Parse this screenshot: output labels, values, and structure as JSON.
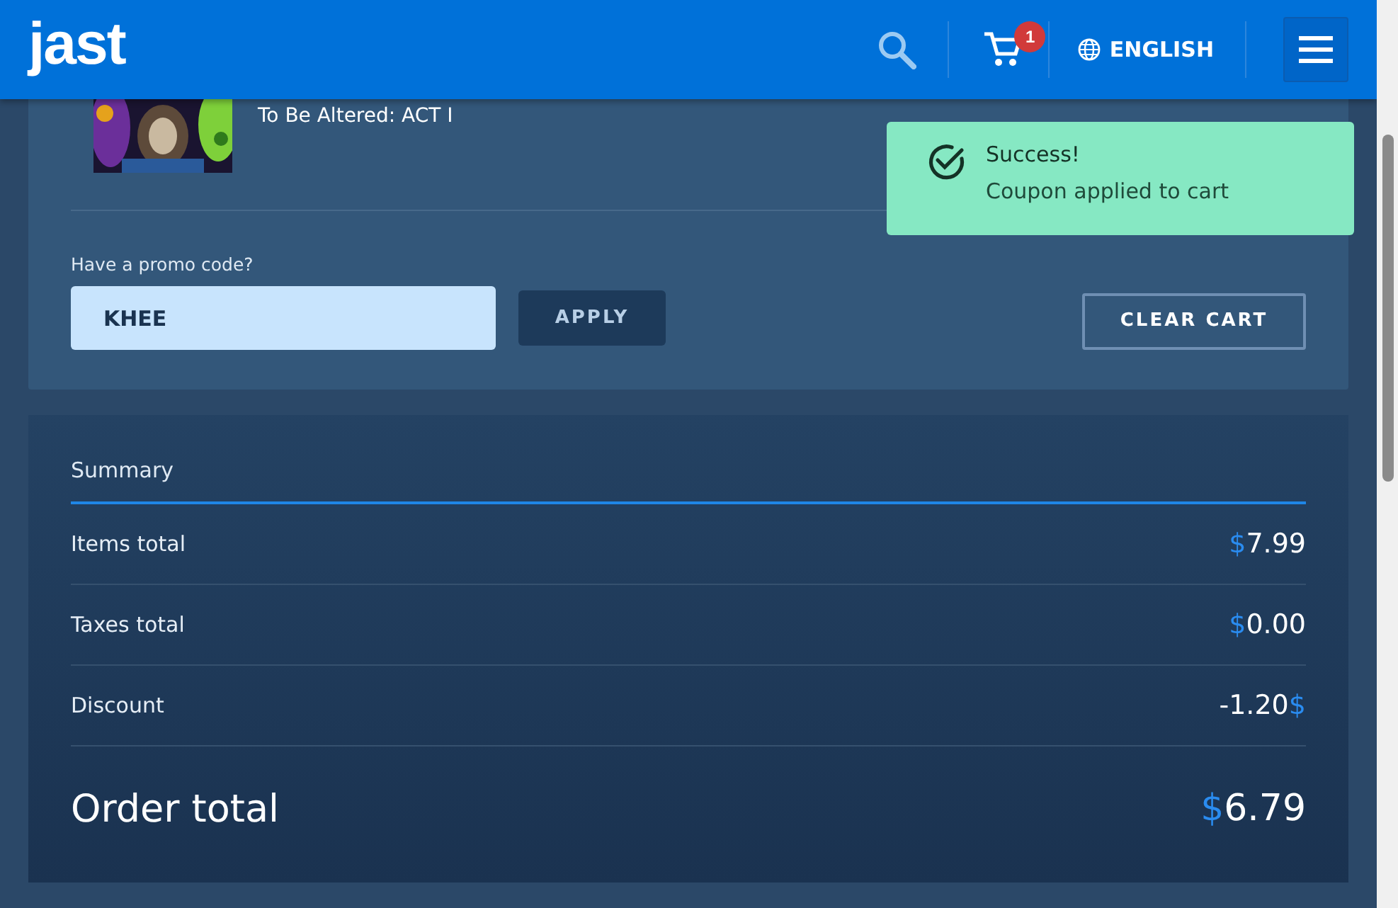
{
  "header": {
    "logo": "jast",
    "cart_count": "1",
    "language": "ENGLISH"
  },
  "cart": {
    "product_title": "To Be Altered: ACT I",
    "promo_label": "Have a promo code?",
    "promo_value": "KHEE",
    "apply_button": "APPLY",
    "clear_button": "CLEAR CART"
  },
  "toast": {
    "title": "Success!",
    "message": "Coupon applied to cart"
  },
  "summary": {
    "title": "Summary",
    "rows": [
      {
        "label": "Items total",
        "currency_before": "$",
        "amount": "7.99"
      },
      {
        "label": "Taxes total",
        "currency_before": "$",
        "amount": "0.00"
      },
      {
        "label": "Discount",
        "amount": "-1.20",
        "currency_after": "$"
      }
    ],
    "total": {
      "label": "Order total",
      "currency_before": "$",
      "amount": "6.79"
    }
  }
}
